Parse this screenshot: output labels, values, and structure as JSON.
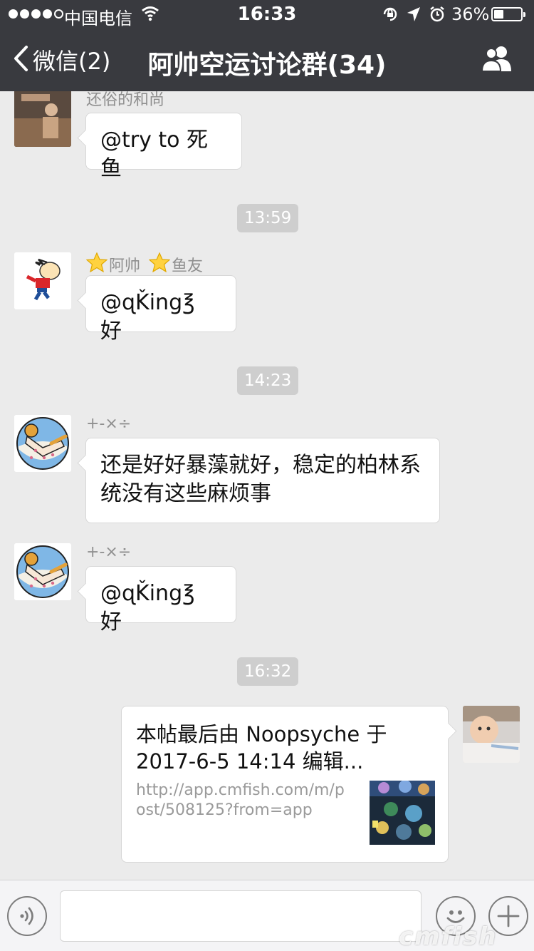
{
  "status_bar": {
    "carrier": "中国电信",
    "time": "16:33",
    "battery_percent_text": "36%",
    "battery_level": 0.36
  },
  "nav": {
    "back_label": "微信(2)",
    "title": "阿帅空运讨论群(34)"
  },
  "messages": [
    {
      "sender": "还俗的和尚",
      "text": "@try to 死鱼"
    },
    {
      "sender_name": "阿帅",
      "sender_tag": "鱼友",
      "text": "@ɋǨing℥ 好"
    },
    {
      "sender": "+-×÷",
      "text": "还是好好暴藻就好，稳定的柏林系统没有这些麻烦事"
    },
    {
      "sender": "+-×÷",
      "text": "@ɋǨing℥ 好"
    }
  ],
  "timestamps": [
    "13:59",
    "14:23",
    "16:32"
  ],
  "link_card": {
    "title": "本帖最后由 Noopsyche 于 2017-6-5 14:14 编辑...",
    "url": "http://app.cmfish.com/m/post/508125?from=app"
  },
  "input": {
    "placeholder": ""
  },
  "watermark": "cmfish",
  "colors": {
    "header_bg": "#393a3f",
    "chat_bg": "#ebebeb",
    "bubble_bg": "#ffffff",
    "timestamp_bg": "#cecece"
  }
}
